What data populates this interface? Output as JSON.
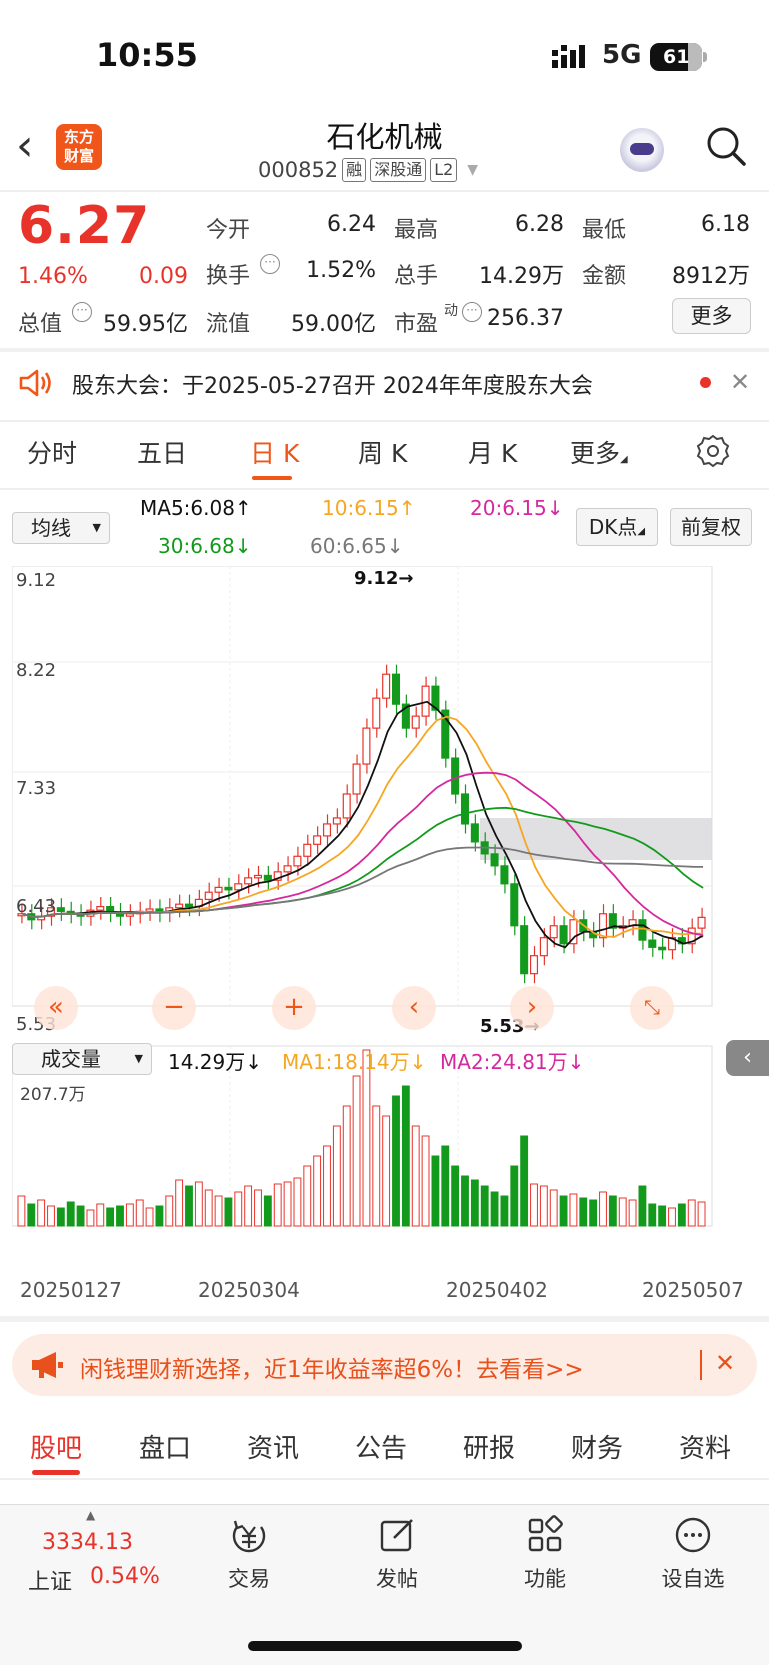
{
  "status": {
    "time": "10:55",
    "network": "5G",
    "battery": "61"
  },
  "header": {
    "logo_line1": "东方",
    "logo_line2": "财富",
    "title": "石化机械",
    "code": "000852",
    "tags": [
      "融",
      "深股通",
      "L2"
    ]
  },
  "quote": {
    "price": "6.27",
    "change_pct": "1.46%",
    "change": "0.09",
    "open_label": "今开",
    "open": "6.24",
    "high_label": "最高",
    "high": "6.28",
    "low_label": "最低",
    "low": "6.18",
    "turnover_label": "换手",
    "turnover": "1.52%",
    "volume_label": "总手",
    "volume": "14.29万",
    "amount_label": "金额",
    "amount": "8912万",
    "mktcap_label": "总值",
    "mktcap": "59.95亿",
    "float_label": "流值",
    "float": "59.00亿",
    "pe_label": "市盈",
    "pe_sup": "动",
    "pe": "256.37",
    "more": "更多"
  },
  "announcement": {
    "text": "股东大会：于2025-05-27召开 2024年年度股东大会"
  },
  "tabs": [
    "分时",
    "五日",
    "日 K",
    "周 K",
    "月 K",
    "更多"
  ],
  "ma_row": {
    "selector": "均线",
    "ma5": "MA5:6.08↑",
    "ma10": "10:6.15↑",
    "ma20": "20:6.15↓",
    "ma30": "30:6.68↓",
    "ma60": "60:6.65↓",
    "dk_button": "DK点",
    "fq_button": "前复权"
  },
  "price_axis": [
    "9.12",
    "8.22",
    "7.33",
    "6.43",
    "5.53"
  ],
  "annotations": {
    "high": "9.12→",
    "low": "5.53→"
  },
  "volume_row": {
    "selector": "成交量",
    "vol": "14.29万↓",
    "ma1": "MA1:18.14万↓",
    "ma2": "MA2:24.81万↓",
    "axis_max": "207.7万"
  },
  "dates": [
    "20250127",
    "20250304",
    "20250402",
    "20250507"
  ],
  "ad": {
    "text": "闲钱理财新选择，近1年收益率超6%！去看看>>"
  },
  "bottom_tabs": [
    "股吧",
    "盘口",
    "资讯",
    "公告",
    "研报",
    "财务",
    "资料"
  ],
  "nav": {
    "index_value": "3334.13",
    "index_name": "上证",
    "index_change": "0.54%",
    "items": [
      "交易",
      "发帖",
      "功能",
      "设自选"
    ]
  },
  "colors": {
    "up": "#e8332a",
    "down": "#139a1c",
    "accent": "#f0561a"
  }
}
